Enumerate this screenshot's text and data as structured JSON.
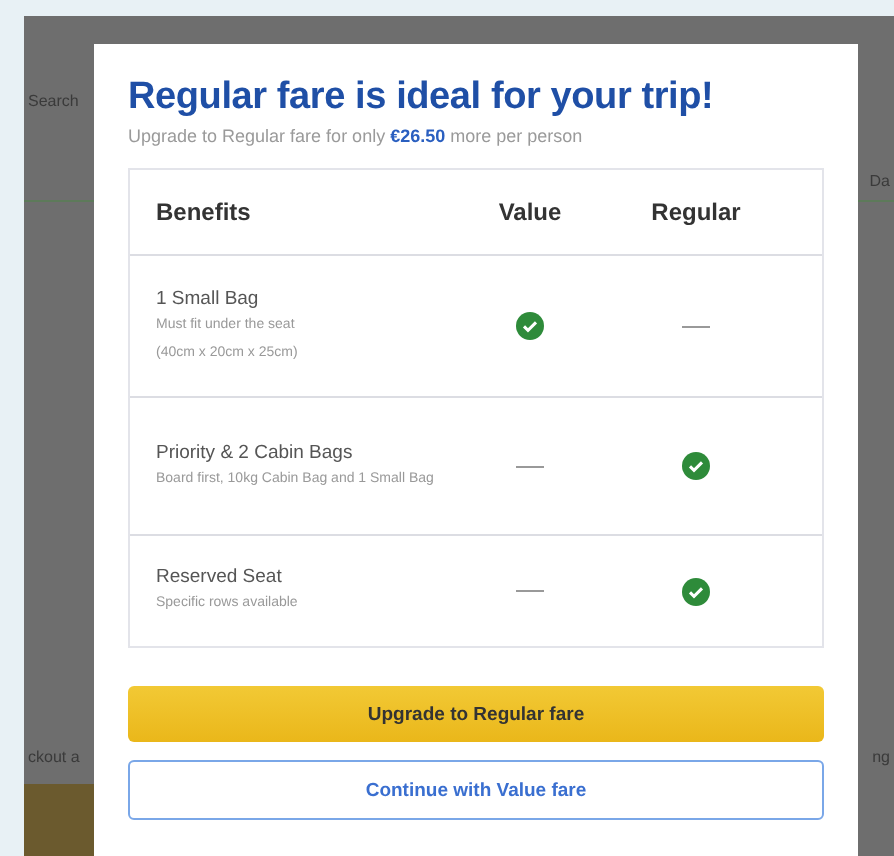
{
  "background": {
    "top_left": "Search",
    "top_right": "Da",
    "bottom_left": "ckout a",
    "bottom_right": "ng"
  },
  "modal": {
    "title": "Regular fare is ideal for your trip!",
    "subtitle": "Upgrade to Regular fare for only **€26.50** more per person",
    "table": {
      "columns": [
        "Benefits",
        "Value",
        "Regular"
      ],
      "rows": [
        {
          "name": "1 Small Bag",
          "details": [
            "Must fit under the seat",
            "(40cm x 20cm x 25cm)"
          ],
          "value": true,
          "regular": false
        },
        {
          "name": "Priority & 2 Cabin Bags",
          "details": [
            "Board first, 10kg Cabin Bag and 1 Small Bag"
          ],
          "value": false,
          "regular": true
        },
        {
          "name": "Reserved Seat",
          "details": [
            "Specific rows available"
          ],
          "value": false,
          "regular": true
        }
      ]
    },
    "buttons": [
      {
        "label": "Upgrade to Regular fare",
        "kind": "primary"
      },
      {
        "label": "Continue with Value fare",
        "kind": "secondary"
      }
    ]
  }
}
